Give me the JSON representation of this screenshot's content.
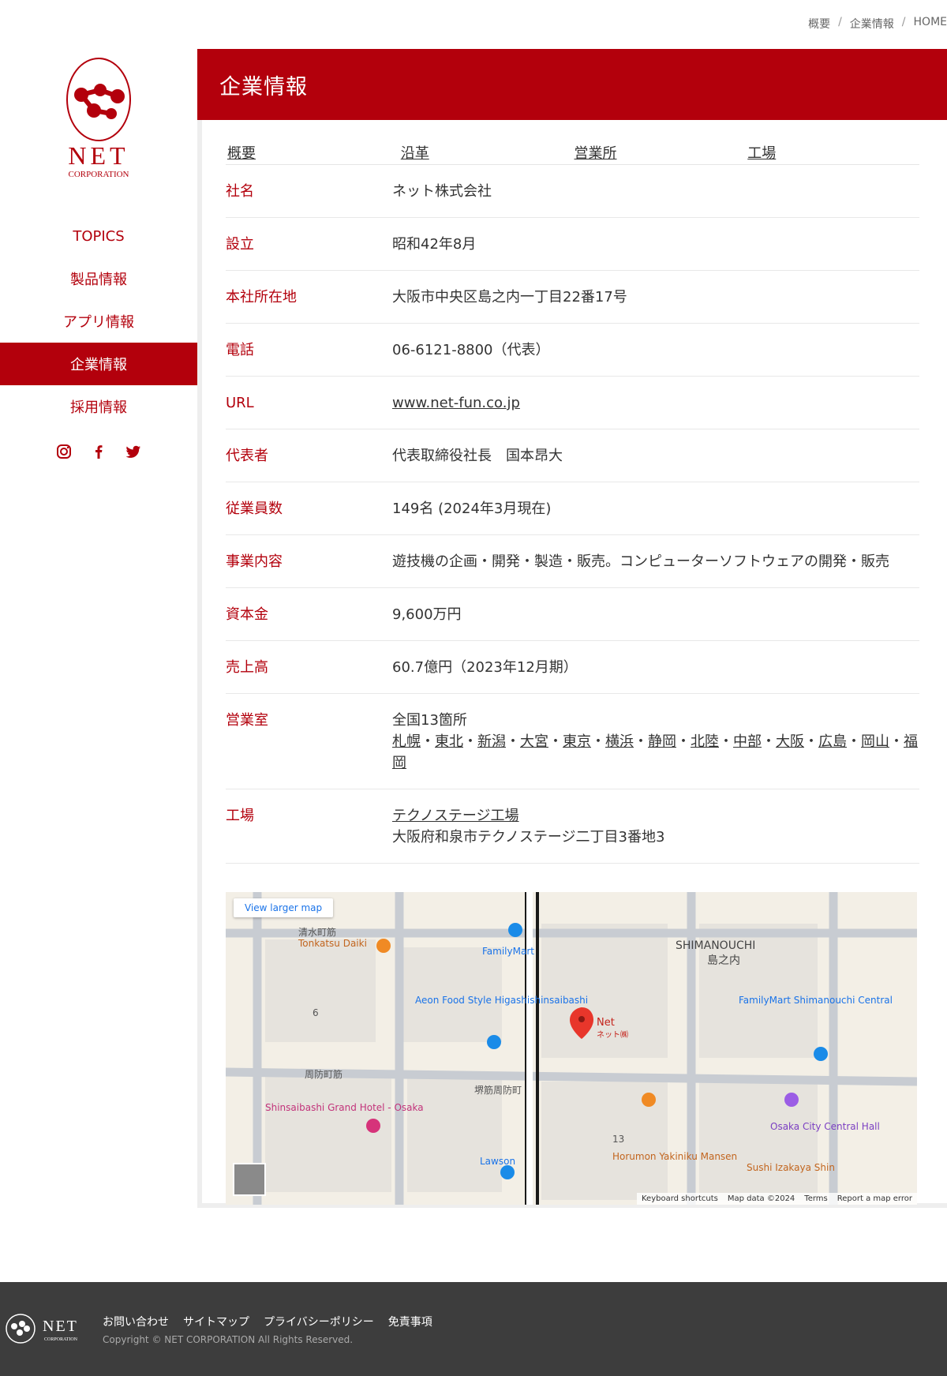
{
  "breadcrumb": [
    "概要",
    "企業情報",
    "HOME"
  ],
  "logo": {
    "name": "NET",
    "sub": "CORPORATION"
  },
  "nav": [
    {
      "label": "TOPICS",
      "active": false
    },
    {
      "label": "製品情報",
      "active": false
    },
    {
      "label": "アプリ情報",
      "active": false
    },
    {
      "label": "企業情報",
      "active": true
    },
    {
      "label": "採用情報",
      "active": false
    }
  ],
  "social": [
    "instagram-icon",
    "facebook-icon",
    "twitter-icon"
  ],
  "page_title": "企業情報",
  "tabs": [
    "概要",
    "沿革",
    "営業所",
    "工場"
  ],
  "rows": [
    {
      "k": "社名",
      "v": "ネット株式会社"
    },
    {
      "k": "設立",
      "v": "昭和42年8月"
    },
    {
      "k": "本社所在地",
      "v": "大阪市中央区島之内一丁目22番17号"
    },
    {
      "k": "電話",
      "v": "06-6121-8800（代表）"
    },
    {
      "k": "URL",
      "v": "www.net-fun.co.jp"
    },
    {
      "k": "代表者",
      "v": "代表取締役社長　国本昂大"
    },
    {
      "k": "従業員数",
      "v": "149名 (2024年3月現在)"
    },
    {
      "k": "事業内容",
      "v": "遊技機の企画・開発・製造・販売。コンピューターソフトウェアの開発・販売"
    },
    {
      "k": "資本金",
      "v": "9,600万円"
    },
    {
      "k": "売上高",
      "v": "60.7億円（2023年12月期）"
    }
  ],
  "offices": {
    "k": "営業室",
    "count": "全国13箇所",
    "list": [
      "札幌",
      "東北",
      "新潟",
      "大宮",
      "東京",
      "横浜",
      "静岡",
      "北陸",
      "中部",
      "大阪",
      "広島",
      "岡山",
      "福岡"
    ]
  },
  "factory": {
    "k": "工場",
    "name": "テクノステージ工場",
    "addr": "大阪府和泉市テクノステージ二丁目3番地3"
  },
  "map": {
    "larger": "View larger map",
    "labels": {
      "area": "SHIMANOUCHI",
      "area_jp": "島之内",
      "pin": "Net",
      "pin_jp": "ネット㈱",
      "street1": "清水町筋",
      "street2": "周防町筋",
      "street3": "堺筋周防町",
      "place1": "Tonkatsu Daiki",
      "place2": "FamilyMart",
      "place3": "Aeon Food Style Higashishinsaibashi",
      "place4": "Shinsaibashi Grand Hotel - Osaka",
      "place5": "Lawson",
      "place6": "Horumon Yakiniku Mansen",
      "place7": "Osaka City Central Hall",
      "place8": "Sushi Izakaya Shin",
      "place9": "FamilyMart Shimanouchi Central",
      "num1": "6",
      "num2": "13"
    },
    "attrib": [
      "Keyboard shortcuts",
      "Map data ©2024",
      "Terms",
      "Report a map error"
    ]
  },
  "footer": {
    "links": [
      "お問い合わせ",
      "サイトマップ",
      "プライバシーポリシー",
      "免責事項"
    ],
    "copyright": "Copyright © NET CORPORATION All Rights Reserved."
  }
}
